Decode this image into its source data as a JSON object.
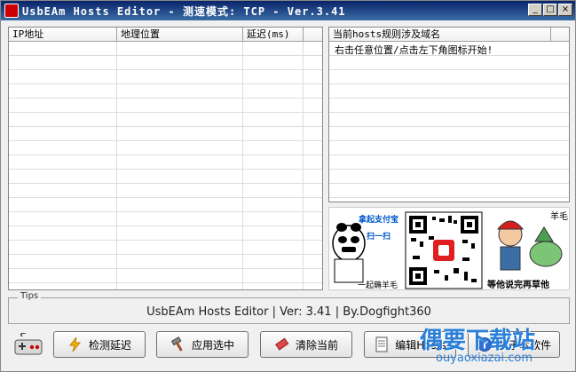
{
  "window": {
    "title": "UsbEAm Hosts Editor - 测速模式: TCP - Ver.3.41"
  },
  "window_buttons": {
    "minimize": "_",
    "maximize": "□",
    "close": "×"
  },
  "left_table": {
    "columns": [
      "IP地址",
      "地理位置",
      "延迟(ms)"
    ]
  },
  "right_table": {
    "column": "当前hosts规则涉及域名",
    "hint": "右击任意位置/点击左下角图标开始!"
  },
  "ad": {
    "tag": "羊毛",
    "left_top": "拿起支付宝",
    "left_mid": "扫一扫",
    "left_bottom": "一起薅羊毛",
    "right_bottom": "等他说完再草他"
  },
  "tips": {
    "legend": "Tips",
    "text": "UsbEAm Hosts Editor | Ver: 3.41 | By.Dogfight360"
  },
  "buttons": {
    "test_latency": "检测延迟",
    "apply_selected": "应用选中",
    "clear_current": "清除当前",
    "edit_hosts": "编辑Hosts",
    "about": "关于本软件"
  },
  "watermark": {
    "title": "偶要下载站",
    "url": "ouyaoxiazai.com"
  },
  "icons": [
    "app-icon",
    "gamepad-icon",
    "lightning-icon",
    "hammer-icon",
    "eraser-icon",
    "document-icon",
    "info-icon"
  ]
}
